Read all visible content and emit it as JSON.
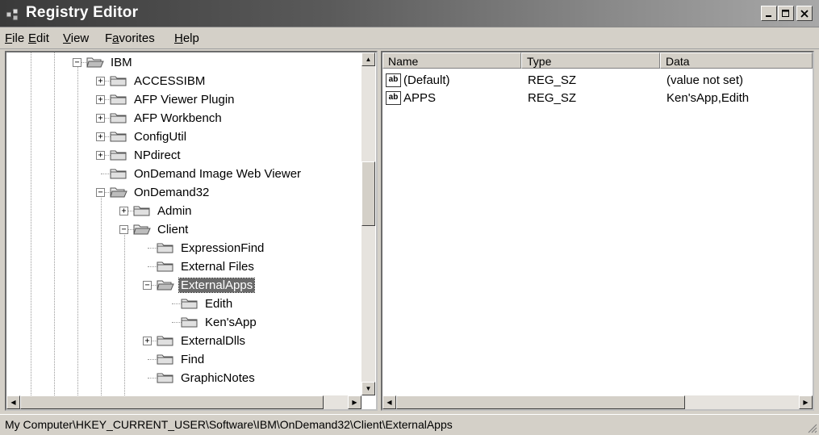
{
  "window": {
    "title": "Registry Editor"
  },
  "menu": [
    {
      "pre": "",
      "key": "F",
      "post": "ile"
    },
    {
      "pre": "",
      "key": "E",
      "post": "dit"
    },
    {
      "pre": "",
      "key": "V",
      "post": "iew"
    },
    {
      "pre": "F",
      "key": "a",
      "post": "vorites"
    },
    {
      "pre": "",
      "key": "H",
      "post": "elp"
    }
  ],
  "tree": [
    {
      "label": "IBM",
      "expander": "-"
    },
    {
      "label": "ACCESSIBM",
      "expander": "+"
    },
    {
      "label": "AFP Viewer Plugin",
      "expander": "+"
    },
    {
      "label": "AFP Workbench",
      "expander": "+"
    },
    {
      "label": "ConfigUtil",
      "expander": "+"
    },
    {
      "label": "NPdirect",
      "expander": "+"
    },
    {
      "label": "OnDemand Image Web Viewer",
      "expander": ""
    },
    {
      "label": "OnDemand32",
      "expander": "-"
    },
    {
      "label": "Admin",
      "expander": "+"
    },
    {
      "label": "Client",
      "expander": "-"
    },
    {
      "label": "ExpressionFind",
      "expander": ""
    },
    {
      "label": "External Files",
      "expander": ""
    },
    {
      "label": "ExternalApps",
      "expander": "-",
      "selected": true
    },
    {
      "label": "Edith",
      "expander": ""
    },
    {
      "label": "Ken'sApp",
      "expander": ""
    },
    {
      "label": "ExternalDlls",
      "expander": "+"
    },
    {
      "label": "Find",
      "expander": ""
    },
    {
      "label": "GraphicNotes",
      "expander": ""
    }
  ],
  "list": {
    "columns": [
      "Name",
      "Type",
      "Data"
    ],
    "rows": [
      {
        "icon": "ab",
        "name": "(Default)",
        "type": "REG_SZ",
        "data": "(value not set)"
      },
      {
        "icon": "ab",
        "name": "APPS",
        "type": "REG_SZ",
        "data": "Ken'sApp,Edith"
      }
    ]
  },
  "status": {
    "path": "My Computer\\HKEY_CURRENT_USER\\Software\\IBM\\OnDemand32\\Client\\ExternalApps"
  }
}
